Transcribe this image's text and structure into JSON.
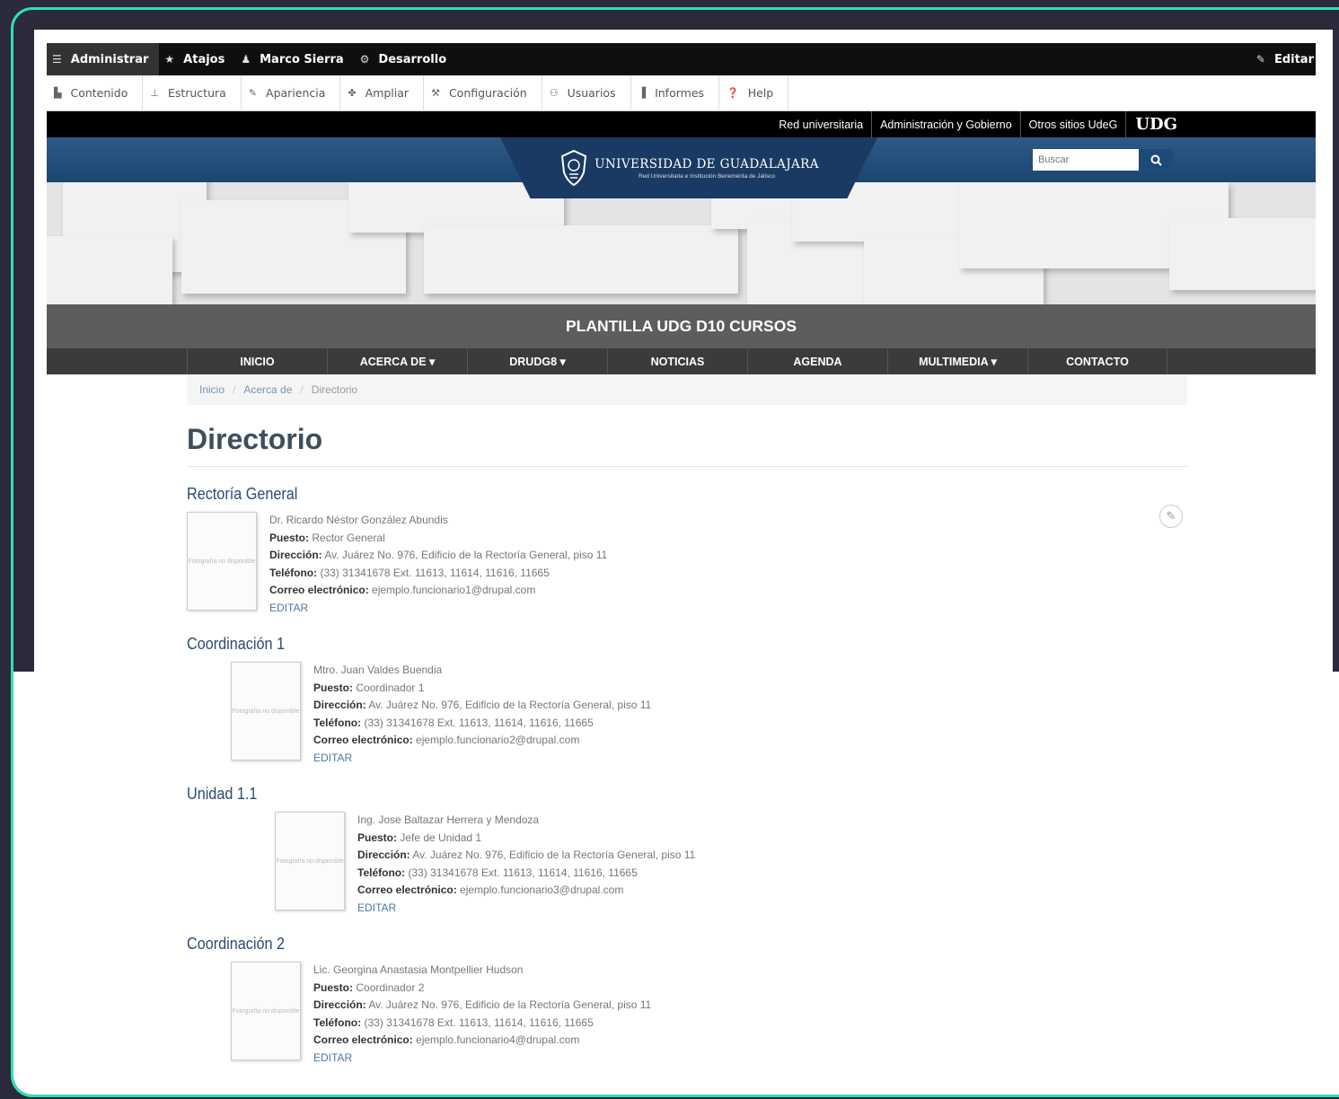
{
  "admin_toolbar": {
    "items": [
      {
        "label": "Administrar",
        "icon": "menu-icon"
      },
      {
        "label": "Atajos",
        "icon": "star-icon"
      },
      {
        "label": "Marco Sierra",
        "icon": "user-icon"
      },
      {
        "label": "Desarrollo",
        "icon": "gear-icon"
      }
    ],
    "edit_label": "Editar"
  },
  "admin_tray": {
    "items": [
      {
        "label": "Contenido",
        "icon": "content-icon"
      },
      {
        "label": "Estructura",
        "icon": "structure-icon"
      },
      {
        "label": "Apariencia",
        "icon": "brush-icon"
      },
      {
        "label": "Ampliar",
        "icon": "puzzle-icon"
      },
      {
        "label": "Configuración",
        "icon": "wrench-icon"
      },
      {
        "label": "Usuarios",
        "icon": "users-icon"
      },
      {
        "label": "Informes",
        "icon": "reports-icon"
      },
      {
        "label": "Help",
        "icon": "help-icon"
      }
    ]
  },
  "network_bar": {
    "links": [
      "Red universitaria",
      "Administración y Gobierno",
      "Otros sitios UdeG"
    ],
    "brand": "UDG"
  },
  "header": {
    "logo_title": "UNIVERSIDAD DE GUADALAJARA",
    "logo_subtitle": "Red Universitaria e Institución Benemérita de Jalisco",
    "search_placeholder": "Buscar"
  },
  "site_title": "PLANTILLA UDG D10 CURSOS",
  "main_nav": [
    {
      "label": "INICIO"
    },
    {
      "label": "ACERCA DE ▾"
    },
    {
      "label": "DRUDG8 ▾"
    },
    {
      "label": "NOTICIAS"
    },
    {
      "label": "AGENDA"
    },
    {
      "label": "MULTIMEDIA ▾"
    },
    {
      "label": "CONTACTO"
    }
  ],
  "breadcrumb": {
    "items": [
      "Inicio",
      "Acerca de"
    ],
    "current": "Directorio"
  },
  "page_title": "Directorio",
  "labels": {
    "puesto": "Puesto:",
    "direccion": "Dirección:",
    "telefono": "Teléfono:",
    "correo": "Correo electrónico:",
    "edit": "EDITAR",
    "photo_placeholder": "Fotografía no disponible"
  },
  "sections": [
    {
      "title": "Rectoría General",
      "name": "Dr. Ricardo Néstor González Abundis",
      "puesto": "Rector General",
      "direccion": "Av. Juárez No. 976, Edificio de la Rectoría General, piso 11",
      "telefono": "(33) 31341678 Ext. 11613, 11614, 11616, 11665",
      "correo": "ejemplo.funcionario1@drupal.com"
    },
    {
      "title": "Coordinación 1",
      "name": "Mtro. Juan Valdes Buendia",
      "puesto": "Coordinador 1",
      "direccion": "Av. Juárez No. 976, Edificio de la Rectoría General, piso 11",
      "telefono": "(33) 31341678 Ext. 11613, 11614, 11616, 11665",
      "correo": "ejemplo.funcionario2@drupal.com"
    },
    {
      "title": "Unidad 1.1",
      "name": "Ing. Jose Baltazar Herrera y Mendoza",
      "puesto": "Jefe de Unidad 1",
      "direccion": "Av. Juárez No. 976, Edificio de la Rectoría General, piso 11",
      "telefono": "(33) 31341678 Ext. 11613, 11614, 11616, 11665",
      "correo": "ejemplo.funcionario3@drupal.com"
    },
    {
      "title": "Coordinación 2",
      "name": "Lic. Georgina Anastasia Montpellier Hudson",
      "puesto": "Coordinador 2",
      "direccion": "Av. Juárez No. 976, Edificio de la Rectoría General, piso 11",
      "telefono": "(33) 31341678 Ext. 11613, 11614, 11616, 11665",
      "correo": "ejemplo.funcionario4@drupal.com"
    }
  ],
  "colors": {
    "accent_frame": "#2de0b7",
    "header_blue": "#1b4570",
    "title_gray": "#5d5d5d",
    "nav_dark": "#3b3b3b",
    "link_blue": "#4a76a8"
  }
}
